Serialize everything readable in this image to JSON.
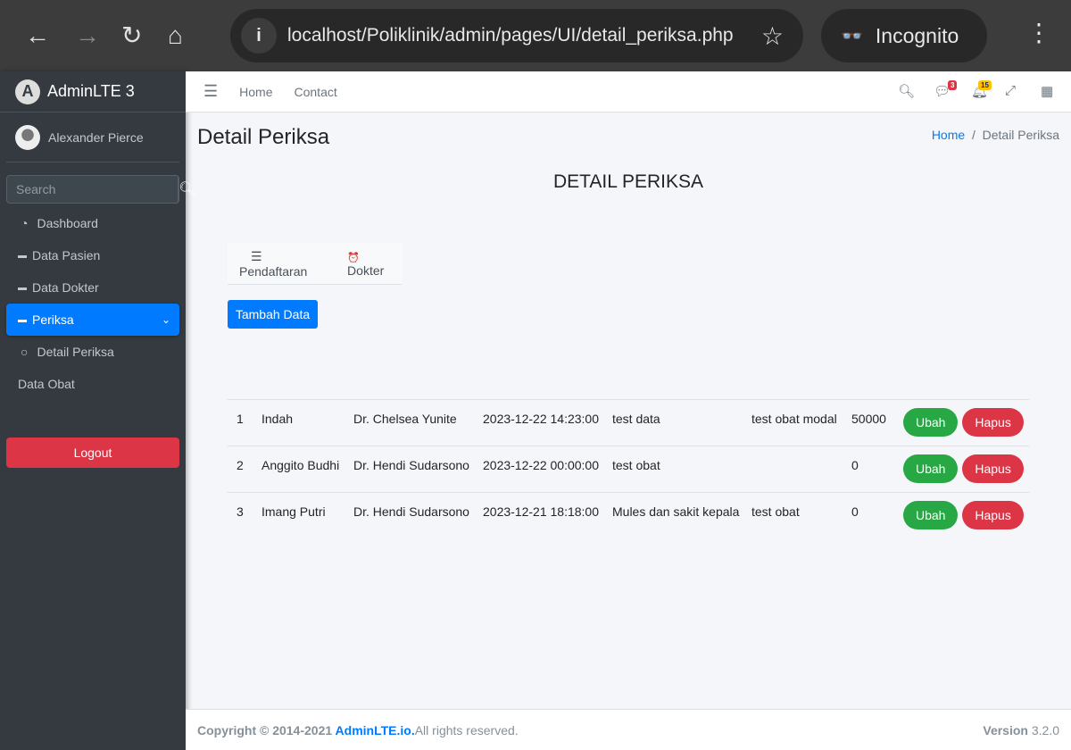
{
  "browser": {
    "url": "localhost/Poliklinik/admin/pages/UI/detail_periksa.php",
    "mode": "Incognito"
  },
  "sidebar": {
    "brand": "AdminLTE 3",
    "user": "Alexander Pierce",
    "search_placeholder": "Search",
    "items": [
      {
        "label": "Dashboard",
        "icon": "tachometer-icon"
      },
      {
        "label": "Data Pasien",
        "icon": "ticket-icon"
      },
      {
        "label": "Data Dokter",
        "icon": "ticket-icon"
      },
      {
        "label": "Periksa",
        "icon": "ticket-icon",
        "active": true
      },
      {
        "label": "Detail Periksa",
        "icon": "circle-icon"
      },
      {
        "label": "Data Obat"
      }
    ],
    "logout": "Logout"
  },
  "topnav": {
    "links": [
      "Home",
      "Contact"
    ],
    "messages_count": "3",
    "notifications_count": "15"
  },
  "page": {
    "title": "Detail Periksa",
    "breadcrumb": [
      "Home",
      "Detail Periksa"
    ],
    "heading": "DETAIL PERIKSA",
    "tabs": [
      {
        "label": "Pendaftaran",
        "icon": "☰"
      },
      {
        "label": "Dokter",
        "icon": "⏰"
      }
    ],
    "add_button": "Tambah Data",
    "edit_label": "Ubah",
    "delete_label": "Hapus"
  },
  "table": {
    "rows": [
      [
        "1",
        "Indah",
        "Dr. Chelsea Yunite",
        "2023-12-22 14:23:00",
        "test data",
        "test obat modal",
        "50000"
      ],
      [
        "2",
        "Anggito Budhi",
        "Dr. Hendi Sudarsono",
        "2023-12-22 00:00:00",
        "test obat",
        "",
        "0"
      ],
      [
        "3",
        "Imang Putri",
        "Dr. Hendi Sudarsono",
        "2023-12-21 18:18:00",
        "Mules dan sakit kepala",
        "test obat",
        "0"
      ]
    ]
  },
  "footer": {
    "copyright": "Copyright © 2014-2021 ",
    "link": "AdminLTE.io.",
    "rights": " All rights reserved.",
    "version_label": "Version",
    "version": " 3.2.0"
  }
}
